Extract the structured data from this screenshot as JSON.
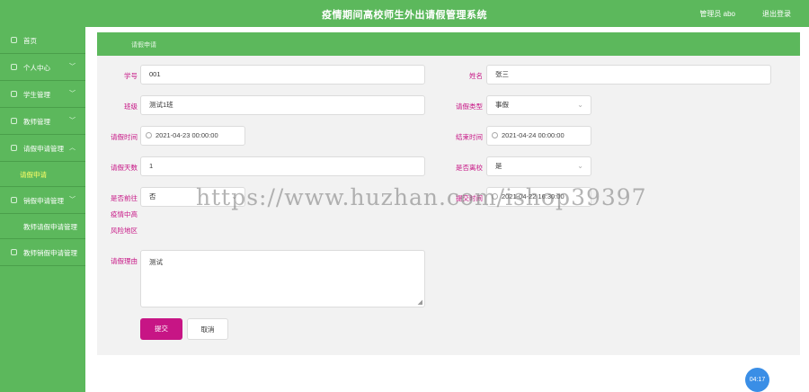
{
  "header": {
    "title": "疫情期间高校师生外出请假管理系统",
    "user": "管理员 abo",
    "logout": "退出登录"
  },
  "sidebar": {
    "items": [
      {
        "label": "首页",
        "arrow": ""
      },
      {
        "label": "个人中心",
        "arrow": "﹀"
      },
      {
        "label": "学生管理",
        "arrow": "﹀"
      },
      {
        "label": "教师管理",
        "arrow": "﹀"
      },
      {
        "label": "请假申请管理",
        "arrow": "︿"
      },
      {
        "label": "请假申请"
      },
      {
        "label": "销假申请管理",
        "arrow": "﹀"
      },
      {
        "label": "教师请假申请管理"
      },
      {
        "label": "教师销假申请管理",
        "arrow": ""
      }
    ]
  },
  "breadcrumb": "请假申请",
  "form": {
    "student_no_label": "学号",
    "student_no": "001",
    "name_label": "姓名",
    "name": "张三",
    "class_label": "班级",
    "class": "测试1班",
    "leave_type_label": "请假类型",
    "leave_type": "事假",
    "start_label": "请假时间",
    "start": "2021-04-23 00:00:00",
    "end_label": "结束时间",
    "end": "2021-04-24 00:00:00",
    "days_label": "请假天数",
    "days": "1",
    "leave_school_label": "是否离校",
    "leave_school": "是",
    "risk_label_1": "是否前往",
    "risk_label_2": "疫情中高",
    "risk_label_3": "风险地区",
    "risk": "否",
    "apply_time_label": "提交时间",
    "apply_time": "2021-04-22 16:30:00",
    "reason_label": "请假理由",
    "reason": "测试",
    "submit": "提交",
    "cancel": "取消"
  },
  "clock": "04:17",
  "watermark": "https://www.huzhan.com/ishop39397",
  "colors": {
    "accent": "#5cb85c",
    "label": "#c71585",
    "submit": "#c71585"
  }
}
